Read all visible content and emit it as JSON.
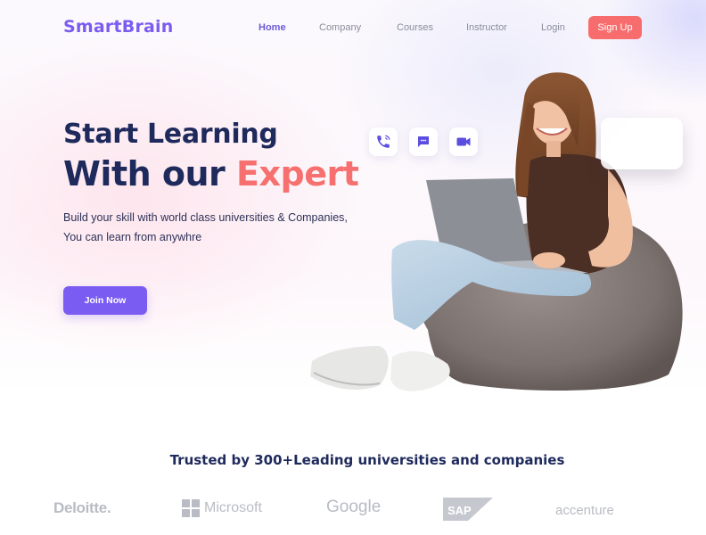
{
  "header": {
    "logo": "SmartBrain",
    "nav": [
      {
        "label": "Home",
        "active": true
      },
      {
        "label": "Company",
        "active": false
      },
      {
        "label": "Courses",
        "active": false
      },
      {
        "label": "Instructor",
        "active": false
      },
      {
        "label": "Login",
        "active": false
      }
    ],
    "signup_label": "Sign Up"
  },
  "hero": {
    "line1": "Start Learning",
    "line2_plain": "With our ",
    "line2_accent": "Expert",
    "description_line1": "Build your skill with world class universities & Companies,",
    "description_line2": "You can learn from anywhre",
    "cta_label": "Join Now",
    "floating_icons": [
      "phone-call-icon",
      "chat-icon",
      "video-call-icon"
    ]
  },
  "trusted": {
    "heading": "Trusted by 300+Leading universities and companies",
    "brands": [
      "Deloitte.",
      "Microsoft",
      "Google",
      "SAP",
      "accenture"
    ]
  },
  "colors": {
    "brand_purple": "#7a5cf2",
    "accent_coral": "#f77070",
    "heading_navy": "#1f2a5c",
    "nav_gray": "#8a8d9c",
    "logo_gray": "#b9bcc4"
  }
}
